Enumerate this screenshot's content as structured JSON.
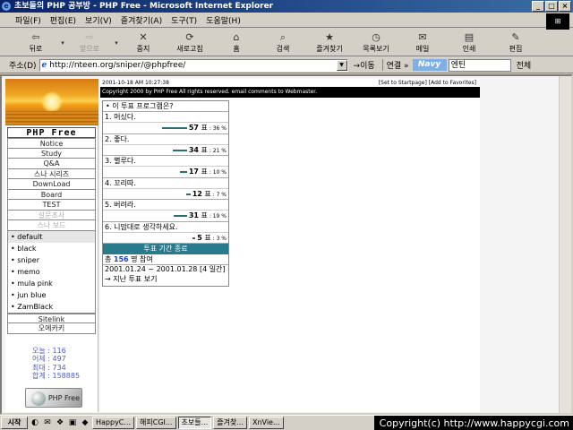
{
  "window": {
    "title": "초보들의 PHP 공부방 - PHP Free - Microsoft Internet Explorer",
    "logo_text": "e",
    "controls": [
      "_",
      "□",
      "×"
    ]
  },
  "menu": [
    "파일(F)",
    "편집(E)",
    "보기(V)",
    "즐겨찾기(A)",
    "도구(T)",
    "도움말(H)"
  ],
  "toolbar": [
    {
      "label": "뒤로",
      "icon": "back-arrow-icon",
      "glyph": "⇦",
      "disabled": false
    },
    {
      "label": "앞으로",
      "icon": "forward-arrow-icon",
      "glyph": "⇨",
      "disabled": true
    },
    {
      "label": "중지",
      "icon": "stop-icon",
      "glyph": "✕",
      "disabled": false
    },
    {
      "label": "새로고침",
      "icon": "refresh-icon",
      "glyph": "⟳",
      "disabled": false
    },
    {
      "label": "홈",
      "icon": "home-icon",
      "glyph": "⌂",
      "disabled": false
    },
    {
      "label": "검색",
      "icon": "search-icon",
      "glyph": "⌕",
      "disabled": false
    },
    {
      "label": "즐겨찾기",
      "icon": "favorites-icon",
      "glyph": "★",
      "disabled": false
    },
    {
      "label": "목록보기",
      "icon": "history-icon",
      "glyph": "◷",
      "disabled": false
    },
    {
      "label": "메일",
      "icon": "mail-icon",
      "glyph": "✉",
      "disabled": false
    },
    {
      "label": "인쇄",
      "icon": "print-icon",
      "glyph": "▤",
      "disabled": false
    },
    {
      "label": "편집",
      "icon": "edit-icon",
      "glyph": "✎",
      "disabled": false
    }
  ],
  "address": {
    "label": "주소(D)",
    "url": "http://nteen.org/sniper/@phpfree/",
    "go_label": "이동",
    "links_label": "연결 »",
    "navy_logo": "Navy",
    "search_value": "엔틴",
    "search_scope": "전체"
  },
  "page": {
    "date": "2001-10-18 AM 10:27:38",
    "header_links": "[Set to Startpage] [Add to Favorites]",
    "copyright": "Copyright 2000 by PHP Free All rights reserved. email comments to Webmaster.",
    "brand": "PHP Free",
    "menu_top": [
      "Notice",
      "Study",
      "Q&A",
      "스나 시리즈",
      "DownLoad",
      "Board",
      "TEST"
    ],
    "menu_gray": [
      "설문조사",
      "스나 보드"
    ],
    "skins": [
      {
        "label": "• default",
        "selected": true
      },
      {
        "label": "• black",
        "selected": false
      },
      {
        "label": "• sniper",
        "selected": false
      },
      {
        "label": "• memo",
        "selected": false
      },
      {
        "label": "• mula pink",
        "selected": false
      },
      {
        "label": "• jun blue",
        "selected": false
      },
      {
        "label": "• ZamBlack",
        "selected": false
      }
    ],
    "menu_bottom": [
      "Sitelink",
      "오에카키"
    ],
    "stats": [
      "오늘 : 116",
      "어제 : 497",
      "최대 : 734",
      "합계 : 158885"
    ],
    "badge": "PHP Free"
  },
  "poll": {
    "question": "• 이 투표 프로그램은?",
    "options": [
      {
        "label": "1. 머싰다.",
        "votes": 57,
        "votes_text": "57",
        "unit": " 표",
        "percent": 36,
        "percent_text": ": 36 %"
      },
      {
        "label": "2. 좋다.",
        "votes": 34,
        "votes_text": "34",
        "unit": " 표",
        "percent": 21,
        "percent_text": ": 21 %"
      },
      {
        "label": "3. 별루다.",
        "votes": 17,
        "votes_text": "17",
        "unit": " 표",
        "percent": 10,
        "percent_text": ": 10 %"
      },
      {
        "label": "4. 꼬리따.",
        "votes": 12,
        "votes_text": "12",
        "unit": " 표",
        "percent": 7,
        "percent_text": ": 7 %"
      },
      {
        "label": "5. 버려라.",
        "votes": 31,
        "votes_text": "31",
        "unit": " 표",
        "percent": 19,
        "percent_text": ": 19 %"
      },
      {
        "label": "6. 니맘대로 생각하세요.",
        "votes": 5,
        "votes_text": "5",
        "unit": " 표",
        "percent": 3,
        "percent_text": ": 3 %"
      }
    ],
    "ended": "투표 기간 종료",
    "total_prefix": "총 ",
    "total": "156",
    "total_suffix": " 명 참여",
    "period": "2001.01.24 ~ 2001.01.28 [4 일간]",
    "past": "→ 지난 투표 보기"
  },
  "taskbar": {
    "start": "시작",
    "quick_icons": [
      "◐",
      "✉",
      "❖",
      "▣",
      "◆"
    ],
    "tasks": [
      {
        "label": "HappyC...",
        "active": false
      },
      {
        "label": "해피CGI...",
        "active": false
      },
      {
        "label": "초보들...",
        "active": true
      },
      {
        "label": "즐겨찾...",
        "active": false
      },
      {
        "label": "XnVie...",
        "active": false
      }
    ],
    "copyright": "Copyright(c) http://www.happycgi.com"
  }
}
